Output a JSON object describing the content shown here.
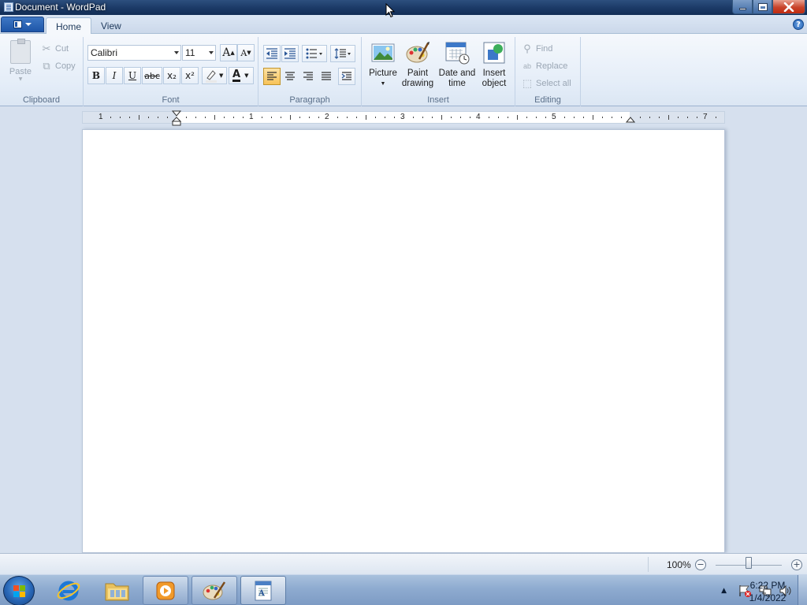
{
  "window": {
    "title": "Document - WordPad"
  },
  "ribbon_tabs": [
    {
      "label": "Home",
      "selected": true
    },
    {
      "label": "View",
      "selected": false
    }
  ],
  "help_label": "?",
  "clipboard": {
    "label": "Clipboard",
    "paste": "Paste",
    "cut": "Cut",
    "copy": "Copy"
  },
  "font": {
    "label": "Font",
    "family": "Calibri",
    "size": "11",
    "grow": "A",
    "shrink": "A",
    "bold": "B",
    "italic": "I",
    "underline": "U",
    "strike": "abc",
    "subscript": "x₂",
    "superscript": "x²",
    "color_letter": "A",
    "text_color": "#1b1b1b",
    "highlight_color": "#ffff00"
  },
  "paragraph": {
    "label": "Paragraph",
    "alignment": "left"
  },
  "insert": {
    "label": "Insert",
    "picture": "Picture",
    "paint_drawing_1": "Paint",
    "paint_drawing_2": "drawing",
    "date_time_1": "Date and",
    "date_time_2": "time",
    "insert_object_1": "Insert",
    "insert_object_2": "object"
  },
  "editing": {
    "label": "Editing",
    "find": "Find",
    "replace": "Replace",
    "select_all": "Select all"
  },
  "ruler": {
    "numbers": [
      "1",
      "1",
      "2",
      "3",
      "4",
      "5",
      "7"
    ]
  },
  "status": {
    "zoom": "100%",
    "zoom_out": "−",
    "zoom_in": "+",
    "zoom_fraction": 0.5
  },
  "taskbar": {
    "time": "6:22 PM",
    "date": "1/4/2022"
  },
  "colors": {
    "accent": "#1d55a8",
    "title_bar": "#1c3b68",
    "close": "#c8432a",
    "active_align": "#f7c359"
  }
}
